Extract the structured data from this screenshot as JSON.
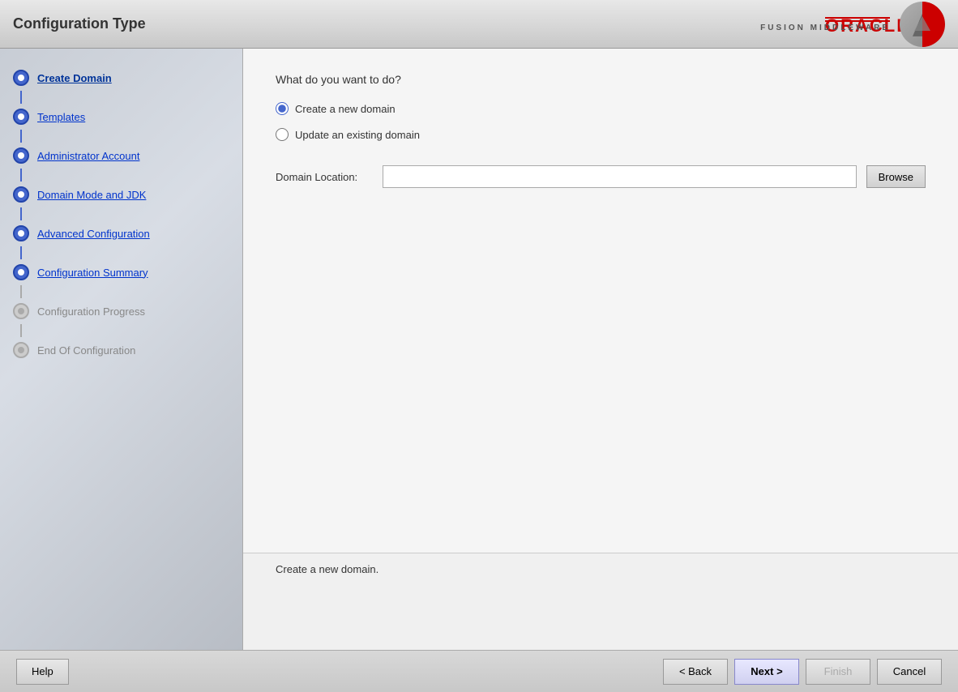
{
  "titleBar": {
    "title": "Configuration Type",
    "oracleName": "ORACLE",
    "oracleLine": "",
    "fusionText": "FUSION MIDDLEWARE"
  },
  "sidebar": {
    "items": [
      {
        "id": "create-domain",
        "label": "Create Domain",
        "state": "active"
      },
      {
        "id": "templates",
        "label": "Templates",
        "state": "completed"
      },
      {
        "id": "administrator-account",
        "label": "Administrator Account",
        "state": "completed"
      },
      {
        "id": "domain-mode-jdk",
        "label": "Domain Mode and JDK",
        "state": "completed"
      },
      {
        "id": "advanced-configuration",
        "label": "Advanced Configuration",
        "state": "completed"
      },
      {
        "id": "configuration-summary",
        "label": "Configuration Summary",
        "state": "completed"
      },
      {
        "id": "configuration-progress",
        "label": "Configuration Progress",
        "state": "inactive"
      },
      {
        "id": "end-of-configuration",
        "label": "End Of Configuration",
        "state": "inactive"
      }
    ]
  },
  "content": {
    "question": "What do you want to do?",
    "options": [
      {
        "id": "create-new-domain",
        "label": "Create a new domain",
        "checked": true
      },
      {
        "id": "update-existing-domain",
        "label": "Update an existing domain",
        "checked": false
      }
    ],
    "domainLocationLabel": "Domain Location:",
    "domainLocationValue": "",
    "domainLocationPlaceholder": "",
    "browseLabel": "Browse"
  },
  "description": {
    "text": "Create a new domain."
  },
  "bottomBar": {
    "helpLabel": "Help",
    "backLabel": "< Back",
    "nextLabel": "Next >",
    "finishLabel": "Finish",
    "cancelLabel": "Cancel"
  }
}
